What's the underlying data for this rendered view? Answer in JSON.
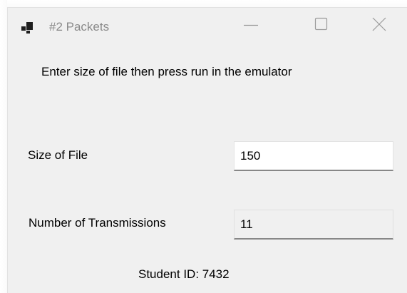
{
  "window": {
    "title": "#2 Packets"
  },
  "icons": {
    "app": "app-window-icon",
    "minimize": "minimize-icon",
    "maximize": "maximize-icon",
    "close": "close-icon"
  },
  "form": {
    "instruction": "Enter size of file then press run in the emulator",
    "size_label": "Size of File",
    "size_value": "150",
    "transmissions_label": "Number of Transmissions",
    "transmissions_value": "11",
    "student_id": "Student ID: 7432"
  },
  "colors": {
    "window_background": "#f0f0f0",
    "title_text": "#8a8a8a",
    "textbox_underline": "#878787"
  }
}
